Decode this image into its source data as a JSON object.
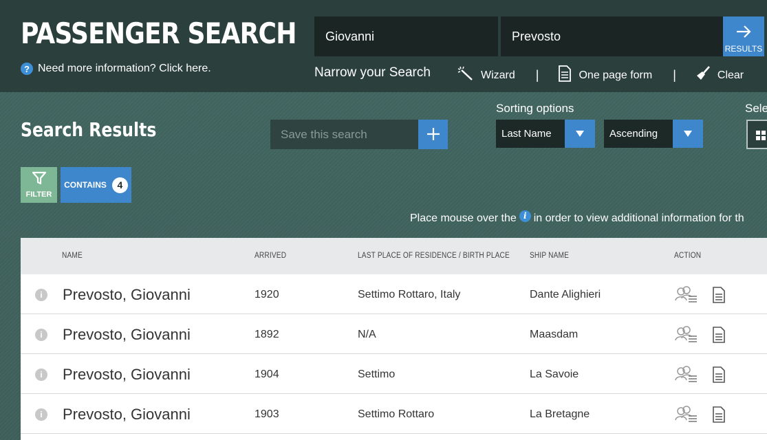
{
  "header": {
    "title": "PASSENGER SEARCH",
    "help_text": "Need more information? Click here.",
    "first_name_value": "Giovanni",
    "last_name_value": "Prevosto",
    "results_label": "RESULTS",
    "narrow_label": "Narrow your Search",
    "toolbar": {
      "wizard": "Wizard",
      "one_page_form": "One page form",
      "clear": "Clear",
      "separator": "|"
    }
  },
  "results": {
    "heading": "Search Results",
    "save_placeholder": "Save this search",
    "sorting_label": "Sorting options",
    "select_label": "Sele",
    "sort_field": "Last Name",
    "sort_order": "Ascending",
    "filter_label": "FILTER",
    "contains_label": "CONTAINS",
    "contains_count": "4",
    "hint_before": "Place mouse over the",
    "hint_after": "in order to view additional information for th"
  },
  "table": {
    "columns": [
      "NAME",
      "ARRIVED",
      "LAST PLACE OF RESIDENCE / BIRTH PLACE",
      "SHIP NAME",
      "ACTION"
    ],
    "rows": [
      {
        "name": "Prevosto, Giovanni",
        "arrived": "1920",
        "place": "Settimo Rottaro, Italy",
        "ship": "Dante Alighieri"
      },
      {
        "name": "Prevosto, Giovanni",
        "arrived": "1892",
        "place": "N/A",
        "ship": "Maasdam"
      },
      {
        "name": "Prevosto, Giovanni",
        "arrived": "1904",
        "place": "Settimo",
        "ship": "La Savoie"
      },
      {
        "name": "Prevosto, Giovanni",
        "arrived": "1903",
        "place": "Settimo Rottaro",
        "ship": "La Bretagne"
      }
    ]
  },
  "colors": {
    "accent_blue": "#3f87cc",
    "filter_green": "#7eb795",
    "header_bg": "#2b3f3c"
  },
  "icons": [
    "help-icon",
    "arrow-right-icon",
    "wand-icon",
    "document-icon",
    "broom-icon",
    "plus-icon",
    "chevron-down-icon",
    "grid-view-icon",
    "filter-icon",
    "info-icon",
    "passengers-icon"
  ]
}
